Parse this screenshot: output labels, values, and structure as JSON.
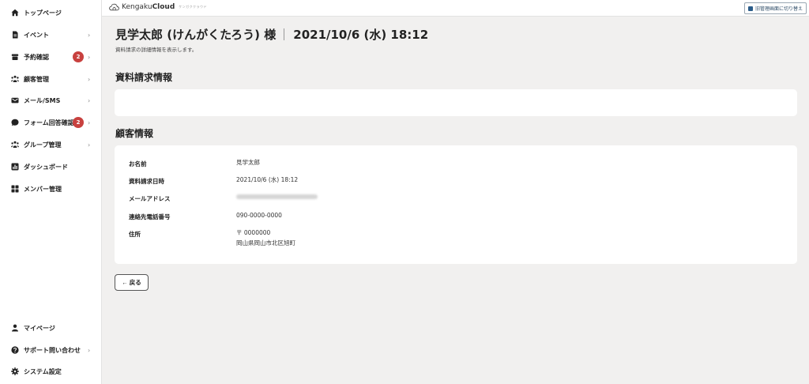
{
  "sidebar": {
    "items": [
      {
        "label": "トップページ",
        "icon": "home-icon"
      },
      {
        "label": "イベント",
        "icon": "document-icon",
        "chevron": "›"
      },
      {
        "label": "予約確認",
        "icon": "box-icon",
        "badge": "2",
        "chevron": "›"
      },
      {
        "label": "顧客管理",
        "icon": "people-icon",
        "chevron": "›"
      },
      {
        "label": "メール/SMS",
        "icon": "mail-icon",
        "chevron": "›"
      },
      {
        "label": "フォーム回答確認",
        "icon": "chat-icon",
        "badge": "2",
        "chevron": "›"
      },
      {
        "label": "グループ管理",
        "icon": "group-icon",
        "chevron": "›"
      },
      {
        "label": "ダッシュボード",
        "icon": "chart-icon"
      },
      {
        "label": "メンバー管理",
        "icon": "grid-icon"
      }
    ],
    "bottom_items": [
      {
        "label": "マイページ",
        "icon": "user-icon"
      },
      {
        "label": "サポート問い合わせ",
        "icon": "help-icon",
        "chevron": "›"
      },
      {
        "label": "システム設定",
        "icon": "gear-icon"
      }
    ]
  },
  "header": {
    "brand_prefix": "Kengaku",
    "brand_bold": "Cloud",
    "brand_sub": "ケンガククラウド",
    "switch_label": "旧管理画面に切り替え"
  },
  "page": {
    "title_name": "見学太郎 (けんがくたろう) 様",
    "title_datetime": "2021/10/6 (水) 18:12",
    "description": "資料請求の詳細情報を表示します。"
  },
  "sections": {
    "request_info_title": "資料請求情報",
    "customer_info_title": "顧客情報"
  },
  "customer": {
    "fields": [
      {
        "label": "お名前",
        "value": "見学太郎"
      },
      {
        "label": "資料請求日時",
        "value": "2021/10/6 (水) 18:12"
      },
      {
        "label": "メールアドレス",
        "value": ""
      },
      {
        "label": "連絡先電話番号",
        "value": "090-0000-0000"
      },
      {
        "label": "住所",
        "value": "〒 0000000",
        "value2": "岡山県岡山市北区旭町"
      }
    ]
  },
  "actions": {
    "back_label": "← 戻る"
  },
  "colors": {
    "badge": "#c8413f",
    "background": "#f1f0ef",
    "card": "#ffffff"
  }
}
